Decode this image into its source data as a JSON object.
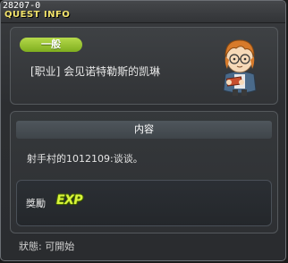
{
  "window": {
    "quest_id": "28207-0",
    "title": "QUEST INFO"
  },
  "quest": {
    "category": "一般",
    "name": "[职业] 会见诺特勒斯的凯琳"
  },
  "content": {
    "header": "内容",
    "text": "射手村的1012109:谈谈。"
  },
  "reward": {
    "label": "獎勵",
    "exp_text": "EXP",
    "icon": "exp-icon"
  },
  "status": {
    "text": "狀態: 可開始"
  },
  "colors": {
    "title": "#f2e36b",
    "badge": "#8fbf2a",
    "exp": "#d9f53a"
  }
}
